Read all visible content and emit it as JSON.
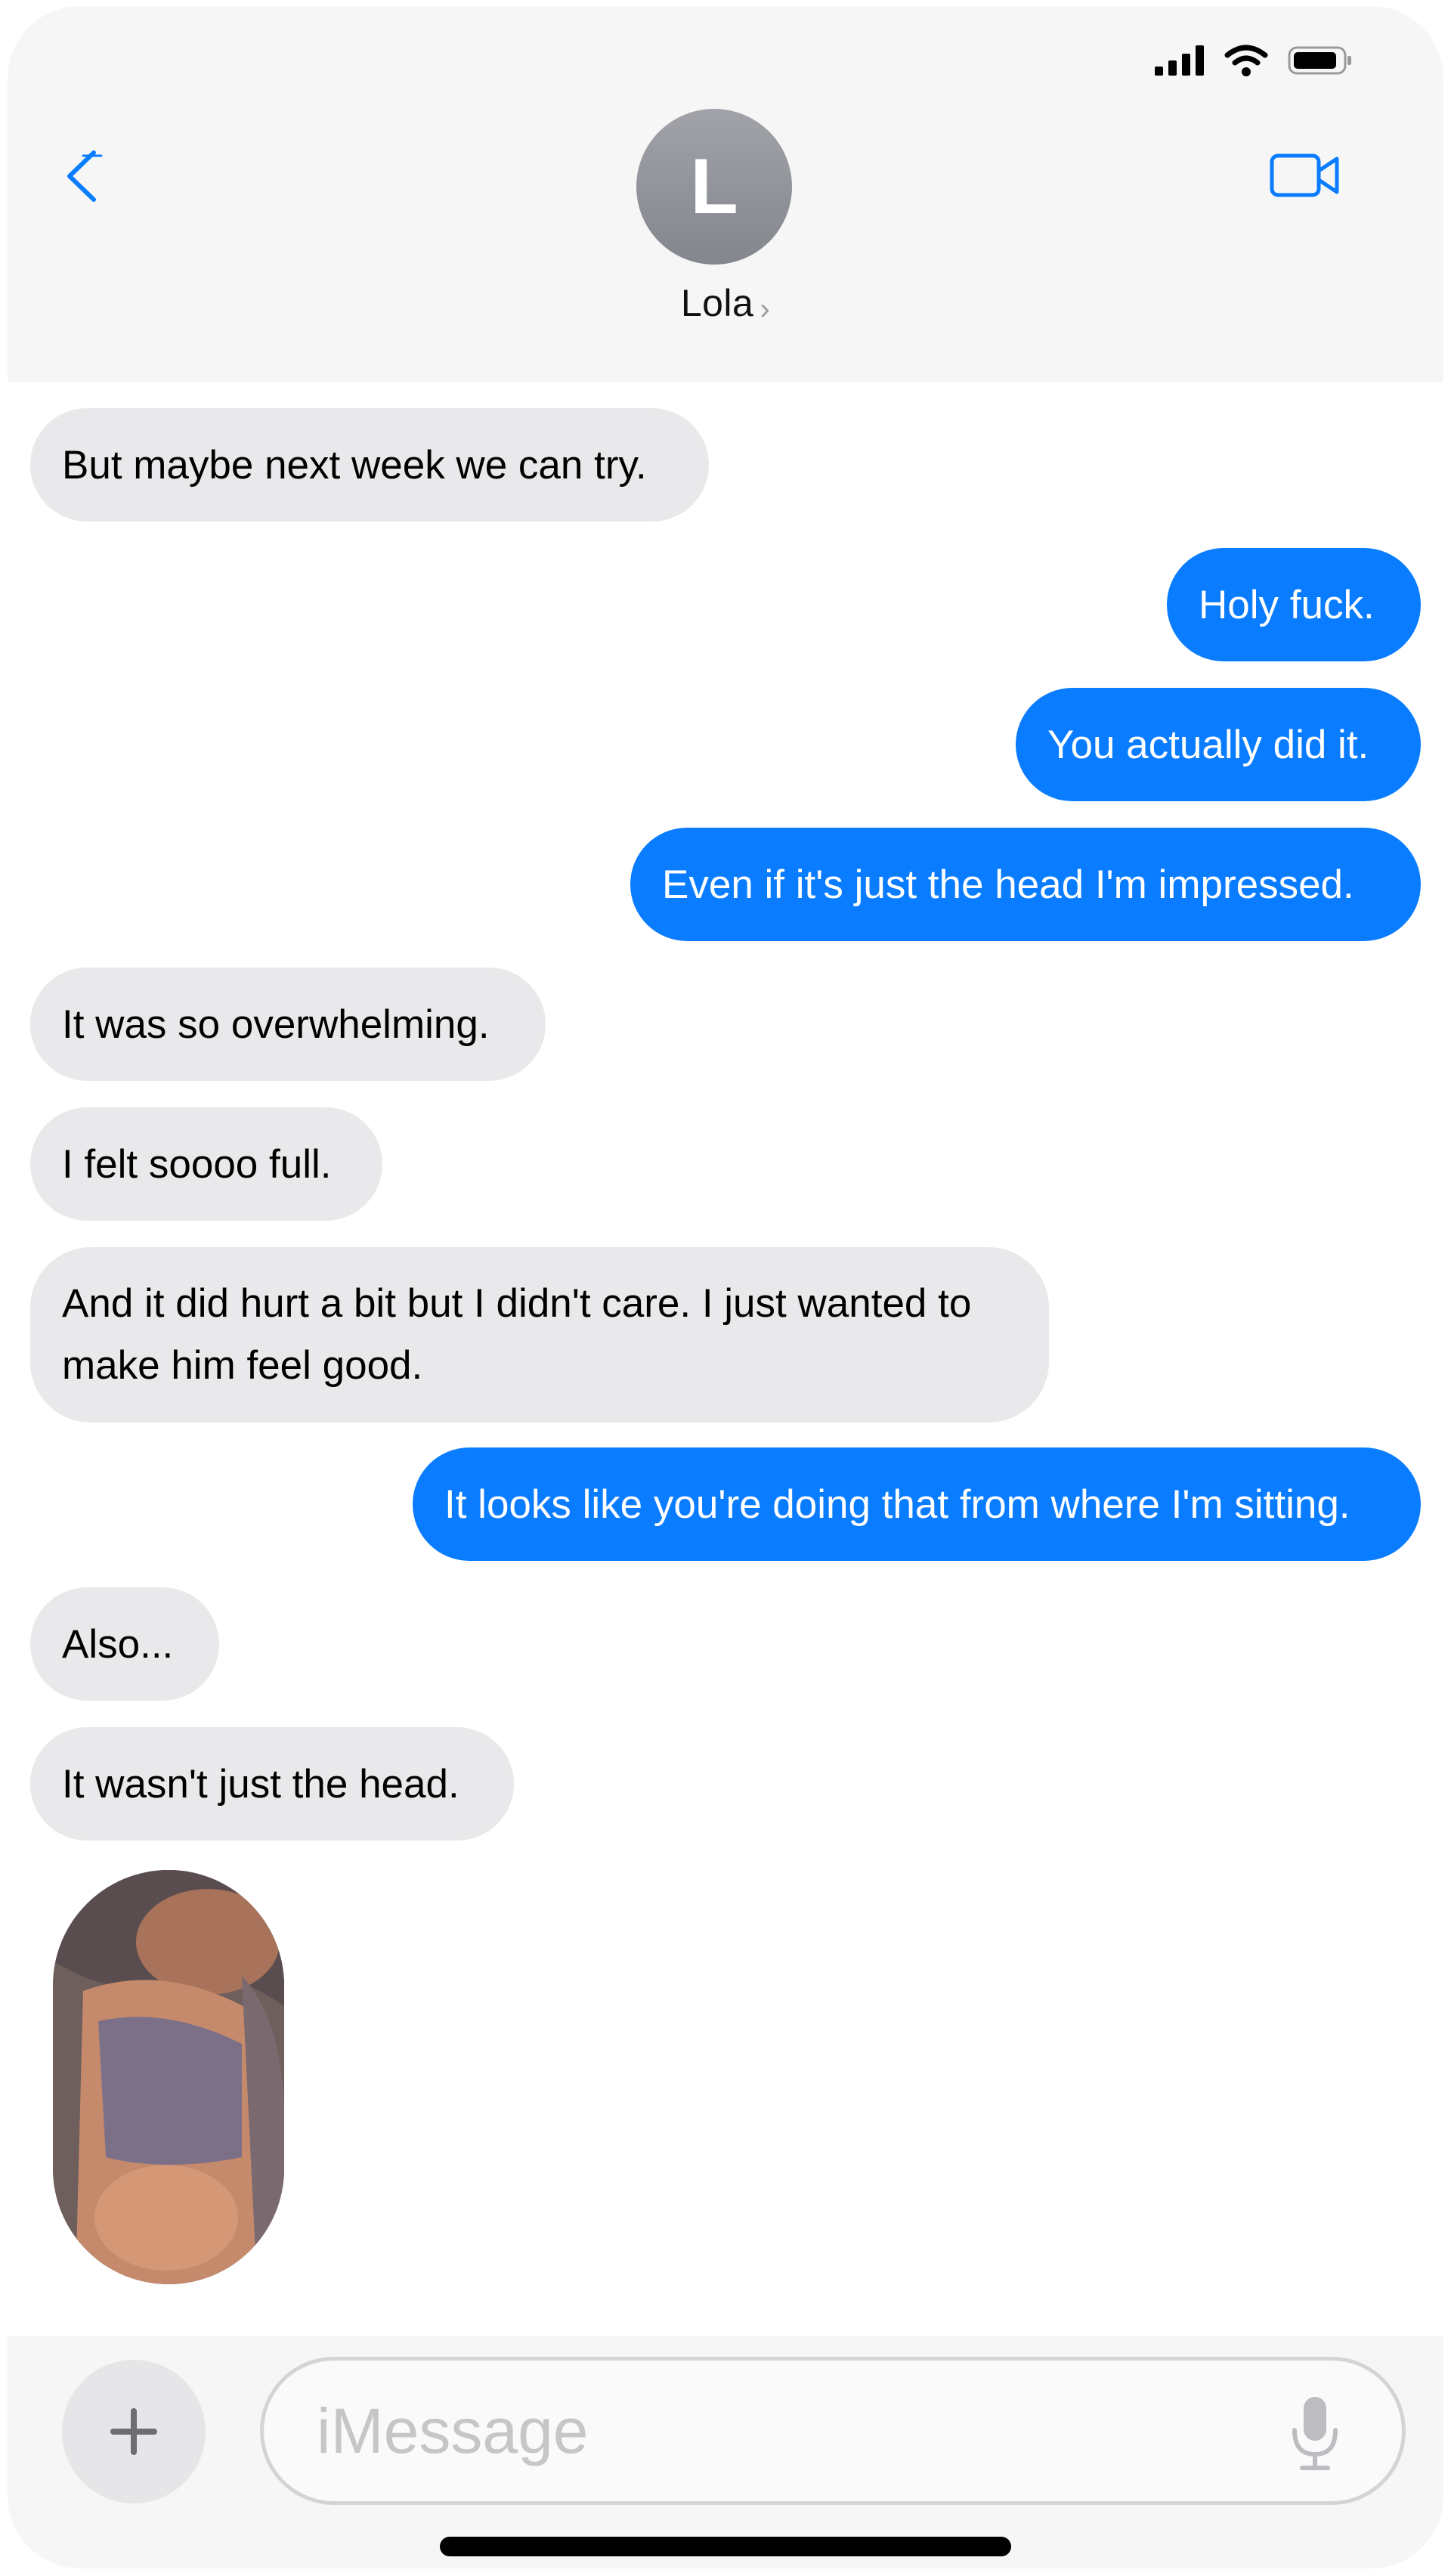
{
  "header": {
    "avatar_initial": "L",
    "contact_name": "Lola",
    "chevron": "›",
    "back_icon": "chevron-left-icon",
    "video_icon": "video-camera-icon"
  },
  "status_bar": {
    "icons": [
      "cellular-signal-icon",
      "wifi-icon",
      "battery-icon"
    ]
  },
  "messages": [
    {
      "from": "them",
      "text": "But maybe next week we can try."
    },
    {
      "from": "me",
      "text": "Holy fuck."
    },
    {
      "from": "me",
      "text": "You actually did it."
    },
    {
      "from": "me",
      "text": "Even if it's just the head I'm impressed."
    },
    {
      "from": "them",
      "text": "It was so overwhelming."
    },
    {
      "from": "them",
      "text": "I felt soooo full."
    },
    {
      "from": "them",
      "text": "And it did hurt a bit but I didn't care. I just wanted to make him feel good."
    },
    {
      "from": "me",
      "text": "It looks like you're doing that from where I'm sitting."
    },
    {
      "from": "them",
      "text": "Also..."
    },
    {
      "from": "them",
      "text": "It wasn't just the head."
    },
    {
      "from": "them",
      "type": "photo"
    }
  ],
  "composer": {
    "placeholder": "iMessage",
    "plus_icon": "plus-icon",
    "mic_icon": "microphone-icon"
  },
  "colors": {
    "outgoing_bubble": "#0a7cff",
    "incoming_bubble": "#e9e9eb",
    "accent": "#0a7cff"
  }
}
